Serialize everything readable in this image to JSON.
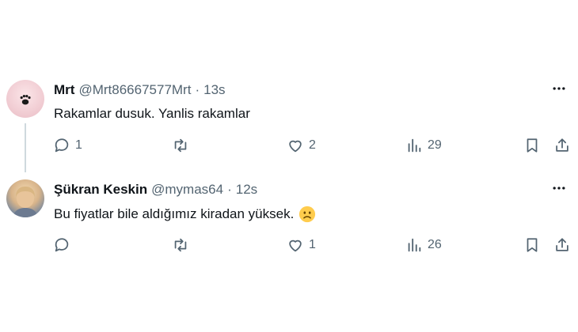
{
  "tweets": [
    {
      "author_name": "Mrt",
      "handle": "@Mrt86667577Mrt",
      "separator": "·",
      "time": "13s",
      "text": "Rakamlar dusuk. Yanlis rakamlar",
      "replies": "1",
      "retweets": "",
      "likes": "2",
      "views": "29",
      "avatar_icon": "paw-print-icon"
    },
    {
      "author_name": "Şükran Keskin",
      "handle": "@mymas64",
      "separator": "·",
      "time": "12s",
      "text": "Bu fiyatlar bile aldığımız kiradan yüksek.",
      "emoji": "frowning-face-emoji",
      "replies": "",
      "retweets": "",
      "likes": "1",
      "views": "26",
      "avatar_icon": "profile-photo"
    }
  ],
  "colors": {
    "text_primary": "#0f1419",
    "text_secondary": "#536471",
    "thread_line": "#cfd9de"
  },
  "icons": [
    "more-icon",
    "reply-icon",
    "retweet-icon",
    "like-icon",
    "views-icon",
    "bookmark-icon",
    "share-icon"
  ]
}
